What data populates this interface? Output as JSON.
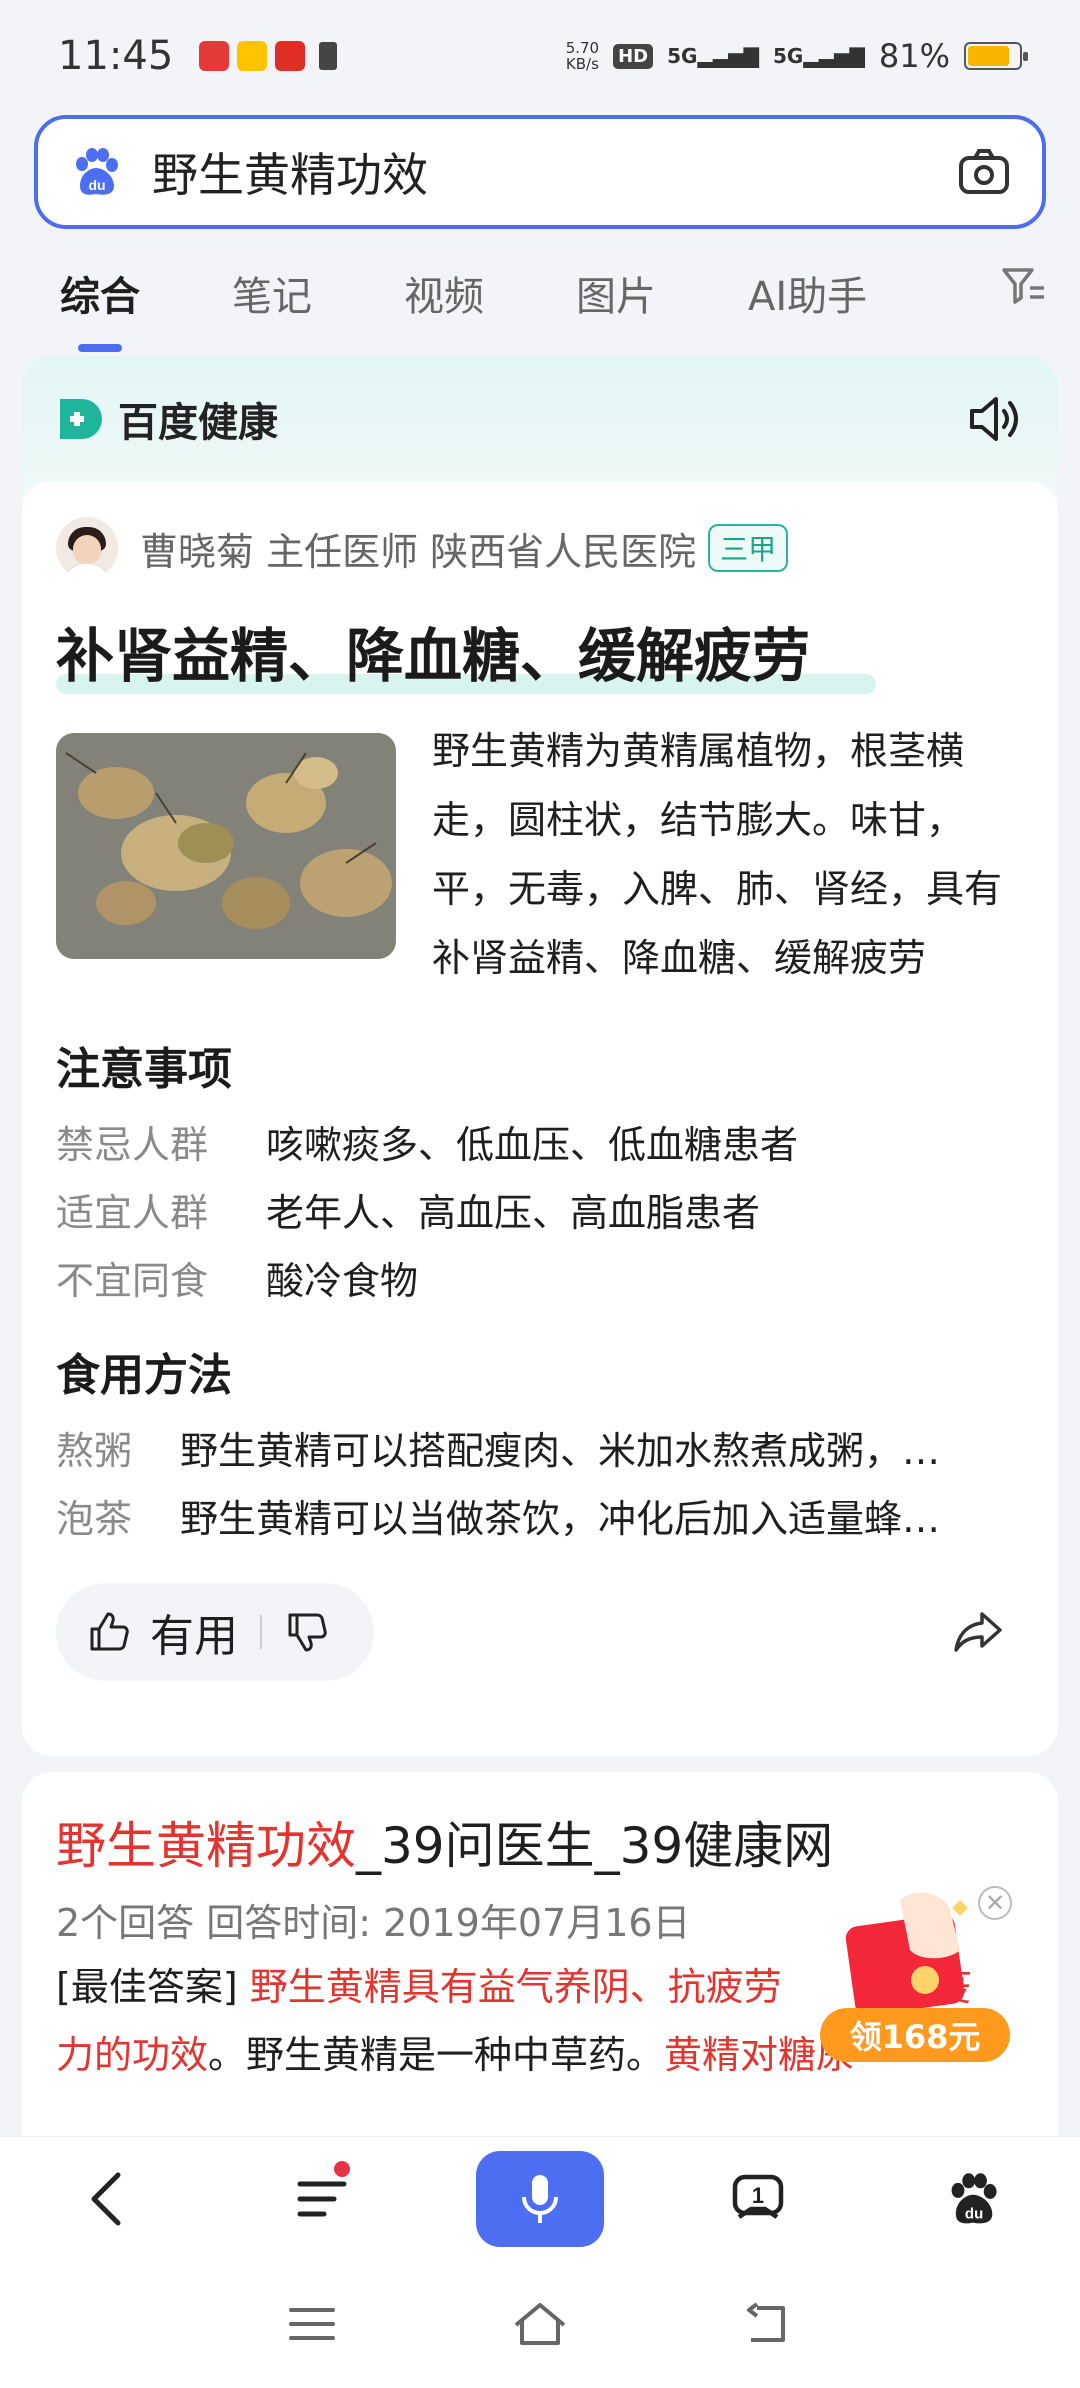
{
  "status_bar": {
    "time": "11:45",
    "net_speed": "5.70\nKB/s",
    "hd": "HD",
    "signal1": "5G",
    "signal2": "5G",
    "battery_percent": "81%",
    "battery_level": 0.81,
    "app_badges": [
      "百度大字版",
      "美团",
      "拼多多"
    ]
  },
  "search": {
    "query": "野生黄精功效",
    "left_icon": "baidu-paw-icon",
    "right_icon": "camera-icon"
  },
  "tabs": [
    {
      "label": "综合",
      "active": true
    },
    {
      "label": "笔记",
      "active": false
    },
    {
      "label": "视频",
      "active": false
    },
    {
      "label": "图片",
      "active": false
    },
    {
      "label": "AI助手",
      "active": false
    }
  ],
  "health_card": {
    "brand": "百度健康",
    "doctor": "曹晓菊 主任医师 陕西省人民医院",
    "hospital_grade": "三甲",
    "headline": "补肾益精、降血糖、缓解疲劳",
    "intro": "野生黄精为黄精属植物，根茎横走，圆柱状，结节膨大。味甘，平，无毒，入脾、肺、肾经，具有补肾益精、降血糖、缓解疲劳",
    "notes_title": "注意事项",
    "notes": [
      {
        "key": "禁忌人群",
        "value": "咳嗽痰多、低血压、低血糖患者"
      },
      {
        "key": "适宜人群",
        "value": "老年人、高血压、高血脂患者"
      },
      {
        "key": "不宜同食",
        "value": "酸冷食物"
      }
    ],
    "usage_title": "食用方法",
    "usage": [
      {
        "key": "熬粥",
        "value": "野生黄精可以搭配瘦肉、米加水熬煮成粥，…"
      },
      {
        "key": "泡茶",
        "value": "野生黄精可以当做茶饮，冲化后加入适量蜂…"
      }
    ],
    "useful_label": "有用"
  },
  "result": {
    "title_red": "野生黄精功效",
    "title_rest": "_39问医生_39健康网",
    "meta": "2个回答  回答时间: 2019年07月16日",
    "body_prefix": "[最佳答案] ",
    "body_red1": "野生黄精具有益气养阴、抗疲劳",
    "body_red1b": "免疫力的功效",
    "body_mid": "。野生黄精是一种中草药。",
    "body_red2": "黄精对糖尿",
    "body_hidden": "、"
  },
  "promo": {
    "label": "领168元",
    "close": "✕"
  },
  "bottom_nav": [
    "back-icon",
    "menu-icon",
    "mic-icon",
    "tabs-icon",
    "baidu-home-icon"
  ],
  "tab_count": "1",
  "colors": {
    "accent": "#4e6ef2",
    "health_green": "#19a78b",
    "red": "#e2352f",
    "promo_orange": "#ff9a1f"
  }
}
